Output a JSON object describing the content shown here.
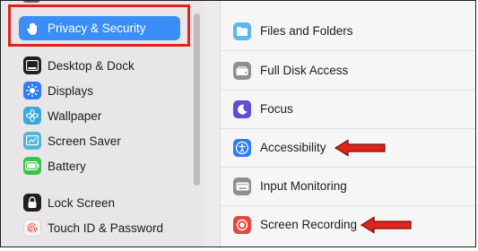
{
  "sidebar": {
    "selected": {
      "label": "Privacy & Security",
      "icon": "hand-icon"
    },
    "group1": [
      {
        "label": "Desktop & Dock",
        "icon": "dock-icon",
        "color": "#1f1f1f"
      },
      {
        "label": "Displays",
        "icon": "sun-icon",
        "color": "#2f7df6"
      },
      {
        "label": "Wallpaper",
        "icon": "flower-icon",
        "color": "#39a8e0"
      },
      {
        "label": "Screen Saver",
        "icon": "screen-saver-icon",
        "color": "#4fb6d8"
      },
      {
        "label": "Battery",
        "icon": "battery-icon",
        "color": "#3cc24a"
      }
    ],
    "group2": [
      {
        "label": "Lock Screen",
        "icon": "lock-icon",
        "color": "#1f1f1f"
      },
      {
        "label": "Touch ID & Password",
        "icon": "fingerprint-icon",
        "color": "#f2f2f2"
      }
    ]
  },
  "main": {
    "rows": [
      {
        "label": "Files and Folders",
        "icon": "folder-icon",
        "color": "#5ab8ef"
      },
      {
        "label": "Full Disk Access",
        "icon": "disk-icon",
        "color": "#8e8e93"
      },
      {
        "label": "Focus",
        "icon": "moon-icon",
        "color": "#5a4fd6"
      },
      {
        "label": "Accessibility",
        "icon": "accessibility-icon",
        "color": "#2f7df6"
      },
      {
        "label": "Input Monitoring",
        "icon": "keyboard-icon",
        "color": "#8e8e93"
      },
      {
        "label": "Screen Recording",
        "icon": "record-icon",
        "color": "#e5483f"
      }
    ]
  },
  "annotations": {
    "highlight_color": "#e0231b",
    "arrow_color": "#e0231b"
  }
}
